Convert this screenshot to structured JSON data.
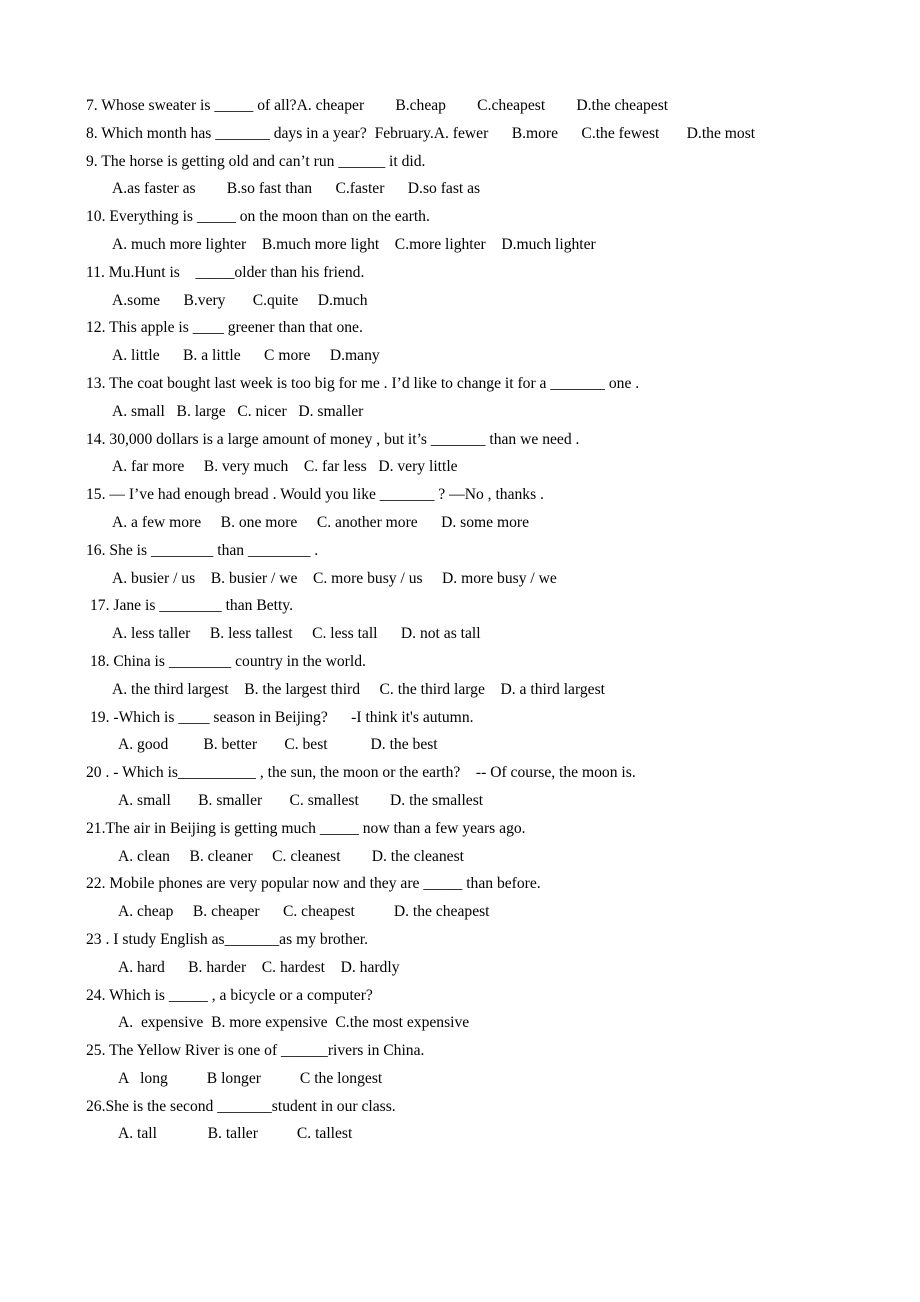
{
  "document": {
    "type": "worksheet",
    "subject": "English grammar multiple-choice exercises (comparatives and superlatives)",
    "background_color": "#ffffff",
    "text_color": "#000000"
  },
  "questions": [
    {
      "number": "7",
      "stem": "7. Whose sweater is _____ of all?",
      "options_inline": true,
      "options_text": "A. cheaper        B.cheap        C.cheapest        D.the cheapest",
      "options": [
        "A. cheaper",
        "B.cheap",
        "C.cheapest",
        "D.the cheapest"
      ],
      "indent": false
    },
    {
      "number": "8",
      "stem": "8. Which month has _______ days in a year?  February.",
      "options_inline": true,
      "options_text": "A. fewer      B.more      C.the fewest       D.the most",
      "options": [
        "A. fewer",
        "B.more",
        "C.the fewest",
        "D.the most"
      ],
      "indent": false
    },
    {
      "number": "9",
      "stem": "9. The horse is getting old and can’t run ______ it did.",
      "options_inline": false,
      "options_text": "A.as faster as        B.so fast than      C.faster      D.so fast as",
      "options": [
        "A.as faster as",
        "B.so fast than",
        "C.faster",
        "D.so fast as"
      ],
      "indent": false,
      "options_indent": "normal"
    },
    {
      "number": "10",
      "stem": "10. Everything is _____ on the moon than on the earth.",
      "options_inline": false,
      "options_text": "A. much more lighter    B.much more light    C.more lighter    D.much lighter",
      "options": [
        "A. much more lighter",
        "B.much more light",
        "C.more lighter",
        "D.much lighter"
      ],
      "indent": false,
      "options_indent": "normal"
    },
    {
      "number": "11",
      "stem": "11. Mu.Hunt is    _____older than his friend.",
      "options_inline": false,
      "options_text": "A.some      B.very       C.quite     D.much",
      "options": [
        "A.some",
        "B.very",
        "C.quite",
        "D.much"
      ],
      "indent": false,
      "options_indent": "normal"
    },
    {
      "number": "12",
      "stem": "12. This apple is ____ greener than that one.",
      "options_inline": false,
      "options_text": "A. little      B. a little      C more     D.many",
      "options": [
        "A. little",
        "B. a little",
        "C more",
        "D.many"
      ],
      "indent": false,
      "options_indent": "normal"
    },
    {
      "number": "13",
      "stem": "13. The coat bought last week is too big for me . I’d like to change it for a _______ one .",
      "options_inline": false,
      "options_text": "A. small   B. large   C. nicer   D. smaller",
      "options": [
        "A. small",
        "B. large",
        "C. nicer",
        "D. smaller"
      ],
      "indent": false,
      "options_indent": "normal"
    },
    {
      "number": "14",
      "stem": "14. 30,000 dollars is a large amount of money , but it’s _______ than we need .",
      "options_inline": false,
      "options_text": "A. far more     B. very much    C. far less   D. very little",
      "options": [
        "A. far more",
        "B. very much",
        "C. far less",
        "D. very little"
      ],
      "indent": false,
      "options_indent": "normal"
    },
    {
      "number": "15",
      "stem": "15. — I’ve had enough bread . Would you like _______ ? —No , thanks .",
      "options_inline": false,
      "options_text": "A. a few more     B. one more     C. another more      D. some more",
      "options": [
        "A. a few more",
        "B. one more",
        "C. another more",
        "D. some more"
      ],
      "indent": false,
      "options_indent": "normal"
    },
    {
      "number": "16",
      "stem": "16. She is ________ than ________ .",
      "options_inline": false,
      "options_text": "A. busier / us    B. busier / we    C. more busy / us     D. more busy / we",
      "options": [
        "A. busier / us",
        "B. busier / we",
        "C. more busy / us",
        "D. more busy / we"
      ],
      "indent": false,
      "options_indent": "normal"
    },
    {
      "number": "17",
      "stem": "17. Jane is ________ than Betty.",
      "options_inline": false,
      "options_text": "A. less taller     B. less tallest     C. less tall      D. not as tall",
      "options": [
        "A. less taller",
        "B. less tallest",
        "C. less tall",
        "D. not as tall"
      ],
      "indent": true,
      "options_indent": "normal"
    },
    {
      "number": "18",
      "stem": "18. China is ________ country in the world.",
      "options_inline": false,
      "options_text": "A. the third largest    B. the largest third     C. the third large    D. a third largest",
      "options": [
        "A. the third largest",
        "B. the largest third",
        "C. the third large",
        "D. a third largest"
      ],
      "indent": true,
      "options_indent": "normal"
    },
    {
      "number": "19",
      "stem": "19. -Which is ____ season in Beijing?      -I think it's autumn.",
      "options_inline": false,
      "options_text": "A. good         B. better       C. best           D. the best",
      "options": [
        "A. good",
        "B. better",
        "C. best",
        "D. the best"
      ],
      "indent": true,
      "options_indent": "deep"
    },
    {
      "number": "20",
      "stem": "20 . - Which is__________ , the sun, the moon or the earth?    -- Of course, the moon is.",
      "options_inline": false,
      "options_text": "A. small       B. smaller       C. smallest        D. the smallest",
      "options": [
        "A. small",
        "B. smaller",
        "C. smallest",
        "D. the smallest"
      ],
      "indent": false,
      "options_indent": "deep"
    },
    {
      "number": "21",
      "stem": "21.The air in Beijing is getting much _____ now than a few years ago.",
      "options_inline": false,
      "options_text": "A. clean     B. cleaner     C. cleanest        D. the cleanest",
      "options": [
        "A. clean",
        "B. cleaner",
        "C. cleanest",
        "D. the cleanest"
      ],
      "indent": false,
      "options_indent": "deep"
    },
    {
      "number": "22",
      "stem": "22. Mobile phones are very popular now and they are _____ than before.",
      "options_inline": false,
      "options_text": "A. cheap     B. cheaper      C. cheapest          D. the cheapest",
      "options": [
        "A. cheap",
        "B. cheaper",
        "C. cheapest",
        "D. the cheapest"
      ],
      "indent": false,
      "options_indent": "deep"
    },
    {
      "number": "23",
      "stem": "23 . I study English as_______as my brother.",
      "options_inline": false,
      "options_text": "A. hard      B. harder    C. hardest    D. hardly",
      "options": [
        "A. hard",
        "B. harder",
        "C. hardest",
        "D. hardly"
      ],
      "indent": false,
      "options_indent": "deep"
    },
    {
      "number": "24",
      "stem": "24. Which is _____ , a bicycle or a computer?",
      "options_inline": false,
      "options_text": "A.  expensive  B. more expensive  C.the most expensive",
      "options": [
        "A.  expensive",
        "B. more expensive",
        "C.the most expensive"
      ],
      "indent": false,
      "options_indent": "deep"
    },
    {
      "number": "25",
      "stem": "25. The Yellow River is one of ______rivers in China.",
      "options_inline": false,
      "options_text": "A   long          B longer          C the longest",
      "options": [
        "A   long",
        "B longer",
        "C the longest"
      ],
      "indent": false,
      "options_indent": "deep"
    },
    {
      "number": "26",
      "stem": "26.She is the second _______student in our class.",
      "options_inline": false,
      "options_text": "A. tall             B. taller          C. tallest",
      "options": [
        "A. tall",
        "B. taller",
        "C. tallest"
      ],
      "indent": false,
      "options_indent": "deep"
    }
  ]
}
